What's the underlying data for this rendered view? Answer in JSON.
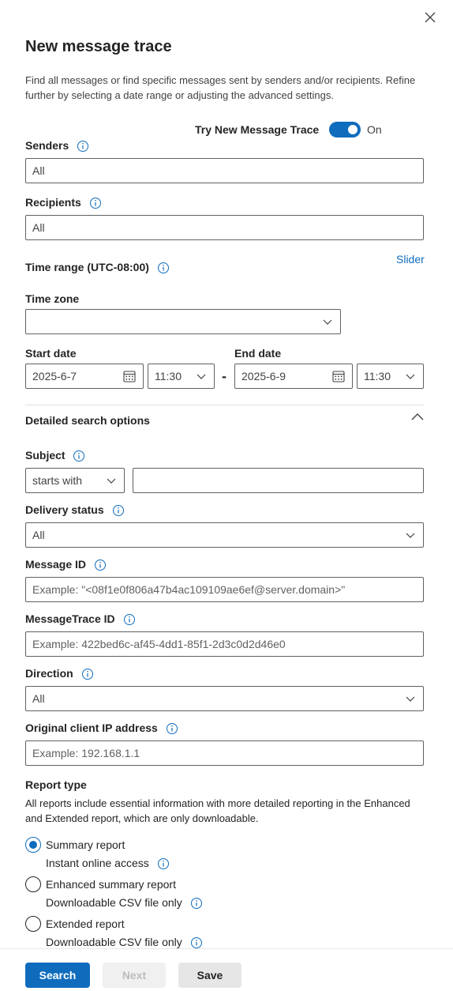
{
  "panel": {
    "title": "New message trace",
    "description": "Find all messages or find specific messages sent by senders and/or recipients. Refine further by selecting a date range or adjusting the advanced settings."
  },
  "toggle": {
    "label": "Try New Message Trace",
    "state": "On",
    "enabled": true
  },
  "senders": {
    "label": "Senders",
    "value": "All"
  },
  "recipients": {
    "label": "Recipients",
    "value": "All"
  },
  "time_range": {
    "label": "Time range (UTC-08:00)",
    "slider_link": "Slider"
  },
  "time_zone": {
    "label": "Time zone",
    "value": ""
  },
  "start": {
    "label": "Start date",
    "date": "2025-6-7",
    "time": "11:30"
  },
  "end": {
    "label": "End date",
    "date": "2025-6-9",
    "time": "11:30"
  },
  "separator": "-",
  "detailed": {
    "label": "Detailed search options"
  },
  "subject": {
    "label": "Subject",
    "operator": "starts with",
    "value": ""
  },
  "delivery_status": {
    "label": "Delivery status",
    "value": "All"
  },
  "message_id": {
    "label": "Message ID",
    "placeholder": "Example: \"<08f1e0f806a47b4ac109109ae6ef@server.domain>\""
  },
  "messagetrace_id": {
    "label": "MessageTrace ID",
    "placeholder": "Example: 422bed6c-af45-4dd1-85f1-2d3c0d2d46e0"
  },
  "direction": {
    "label": "Direction",
    "value": "All"
  },
  "client_ip": {
    "label": "Original client IP address",
    "placeholder": "Example: 192.168.1.1"
  },
  "report_type": {
    "label": "Report type",
    "description": "All reports include essential information with more detailed reporting in the Enhanced and Extended report, which are only downloadable.",
    "options": [
      {
        "label": "Summary report",
        "sub": "Instant online access",
        "selected": true
      },
      {
        "label": "Enhanced summary report",
        "sub": "Downloadable CSV file only",
        "selected": false
      },
      {
        "label": "Extended report",
        "sub": "Downloadable CSV file only",
        "selected": false
      }
    ]
  },
  "footer": {
    "search": "Search",
    "next": "Next",
    "save": "Save"
  },
  "colors": {
    "accent": "#0f6cbd",
    "text": "#242424",
    "border": "#616161"
  },
  "icons": [
    "close-icon",
    "info-icon",
    "chevron-down-icon",
    "calendar-icon",
    "chevron-up-icon"
  ]
}
